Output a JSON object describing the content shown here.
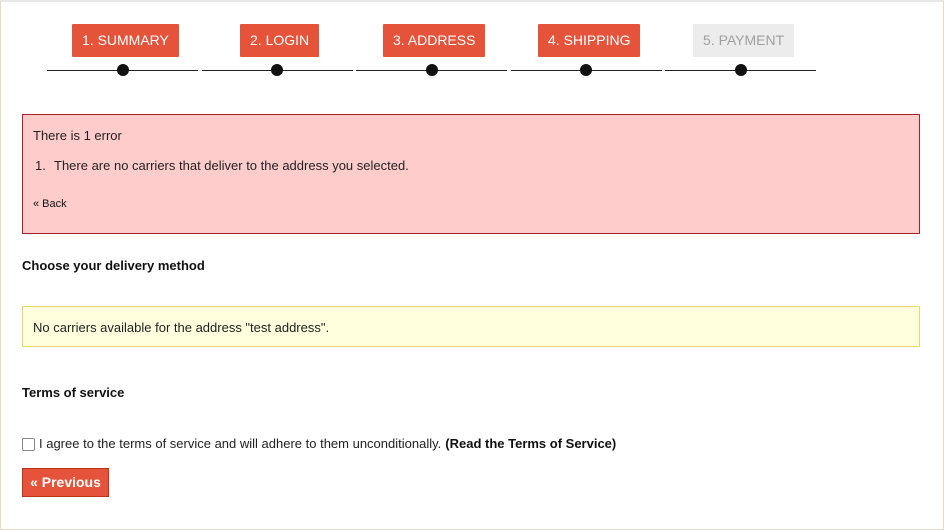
{
  "steps": [
    {
      "label": "1. SUMMARY",
      "active": true
    },
    {
      "label": "2. LOGIN",
      "active": true
    },
    {
      "label": "3. ADDRESS",
      "active": true
    },
    {
      "label": "4. SHIPPING",
      "active": true
    },
    {
      "label": "5. PAYMENT",
      "active": false
    }
  ],
  "error": {
    "title": "There is 1 error",
    "items": [
      {
        "num": "1.",
        "text": "There are no carriers that deliver to the address you selected."
      }
    ],
    "back_label": "« Back"
  },
  "delivery": {
    "title": "Choose your delivery method",
    "warning": "No carriers available for the address \"test address\"."
  },
  "terms": {
    "title": "Terms of service",
    "checkbox_label": "I agree to the terms of service and will adhere to them unconditionally.",
    "link_label": "(Read the Terms of Service)",
    "checked": false
  },
  "buttons": {
    "previous_label": "« Previous"
  },
  "colors": {
    "accent": "#e5533a",
    "error_bg": "#ffcccc",
    "error_border": "#b0202a",
    "warning_bg": "#ffffdd",
    "disabled_bg": "#ececec"
  }
}
